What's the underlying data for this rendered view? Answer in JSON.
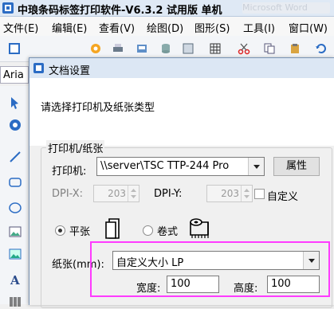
{
  "window": {
    "title": "中琅条码标签打印软件-V6.3.2 试用版 单机",
    "blurred_tab": "Microsoft Word"
  },
  "menu": [
    "文件(E)",
    "编辑(E)",
    "查看(V)",
    "绘图(D)",
    "图形(S)",
    "工具(I)",
    "窗口(W)"
  ],
  "font_box": "Aria",
  "dialog": {
    "title": "文档设置",
    "prompt": "请选择打印机及纸张类型",
    "group_title": "打印机/纸张",
    "printer_label": "打印机:",
    "printer_value": "\\\\server\\TSC TTP-244 Pro",
    "properties_button": "属性",
    "dpix_label": "DPI-X:",
    "dpix_value": "203",
    "dpiy_label": "DPI-Y:",
    "dpiy_value": "203",
    "custom_label": "自定义",
    "sheet_label": "平张",
    "roll_label": "卷式",
    "paper_label": "纸张(mm):",
    "paper_value": "自定义大小 LP",
    "width_label": "宽度:",
    "width_value": "100",
    "height_label": "高度:",
    "height_value": "100"
  },
  "colors": {
    "highlight": "#ff3bff",
    "accent": "#2b6cc4"
  }
}
